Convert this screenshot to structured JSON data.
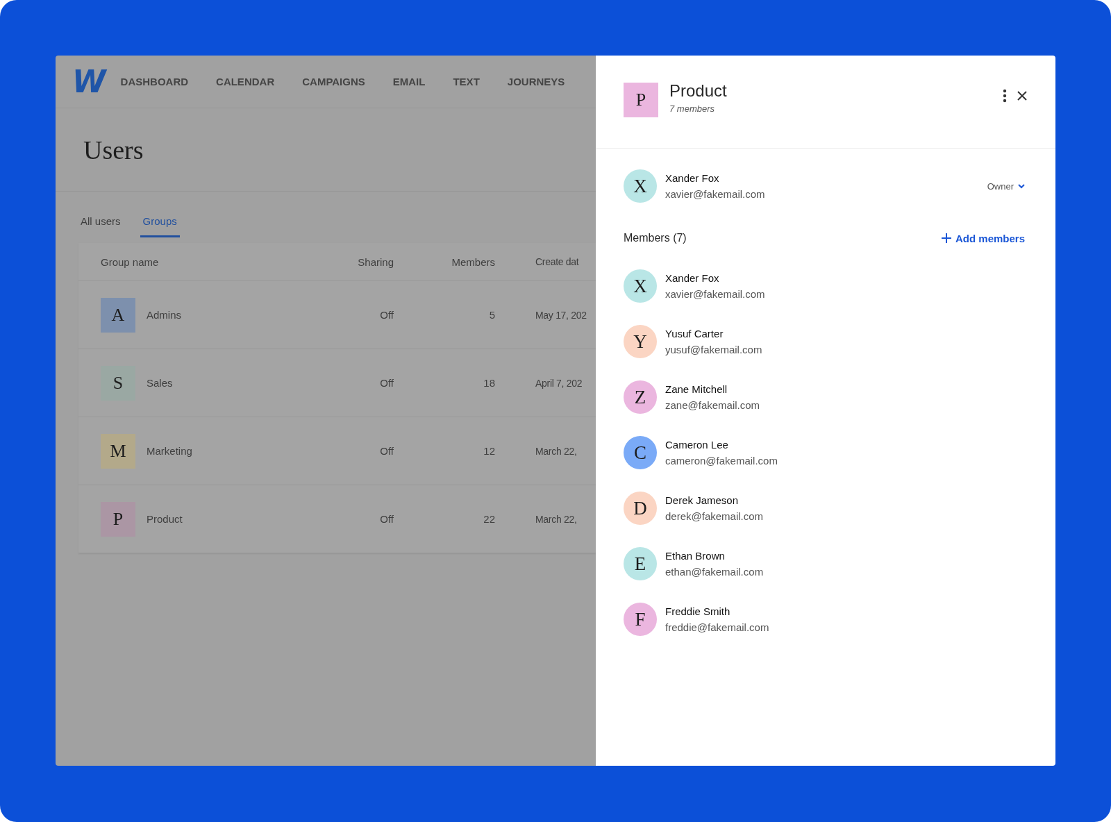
{
  "nav": {
    "logo": "W",
    "items": [
      "DASHBOARD",
      "CALENDAR",
      "CAMPAIGNS",
      "EMAIL",
      "TEXT",
      "JOURNEYS"
    ]
  },
  "page": {
    "title": "Users"
  },
  "tabs": [
    {
      "label": "All users",
      "selected": false
    },
    {
      "label": "Groups",
      "selected": true
    }
  ],
  "table": {
    "columns": [
      "Group name",
      "Sharing",
      "Members",
      "Create dat"
    ],
    "rows": [
      {
        "initial": "A",
        "color": "#7d90ad",
        "name": "Admins",
        "sharing": "Off",
        "members": "5",
        "created": "May 17, 202"
      },
      {
        "initial": "S",
        "color": "#9aa8a3",
        "name": "Sales",
        "sharing": "Off",
        "members": "18",
        "created": "April 7, 202"
      },
      {
        "initial": "M",
        "color": "#b3a98a",
        "name": "Marketing",
        "sharing": "Off",
        "members": "12",
        "created": "March 22,"
      },
      {
        "initial": "P",
        "color": "#ab96a4",
        "name": "Product",
        "sharing": "Off",
        "members": "22",
        "created": "March 22,"
      }
    ]
  },
  "panel": {
    "group": {
      "initial": "P",
      "color": "#ebb6df",
      "name": "Product",
      "subtitle": "7 members"
    },
    "owner": {
      "initial": "X",
      "color": "#b9e6e6",
      "name": "Xander Fox",
      "email": "xavier@fakemail.com",
      "role": "Owner"
    },
    "members_label": "Members (7)",
    "add_button": "Add members",
    "members": [
      {
        "initial": "X",
        "color": "#b9e6e6",
        "name": "Xander Fox",
        "email": "xavier@fakemail.com"
      },
      {
        "initial": "Y",
        "color": "#fbd5c3",
        "name": "Yusuf Carter",
        "email": "yusuf@fakemail.com"
      },
      {
        "initial": "Z",
        "color": "#ebb6df",
        "name": "Zane Mitchell",
        "email": "zane@fakemail.com"
      },
      {
        "initial": "C",
        "color": "#7aaaf7",
        "name": "Cameron Lee",
        "email": "cameron@fakemail.com"
      },
      {
        "initial": "D",
        "color": "#fbd5c3",
        "name": "Derek Jameson",
        "email": "derek@fakemail.com"
      },
      {
        "initial": "E",
        "color": "#b9e6e6",
        "name": "Ethan Brown",
        "email": "ethan@fakemail.com"
      },
      {
        "initial": "F",
        "color": "#ebb6df",
        "name": "Freddie Smith",
        "email": "freddie@fakemail.com"
      }
    ]
  }
}
